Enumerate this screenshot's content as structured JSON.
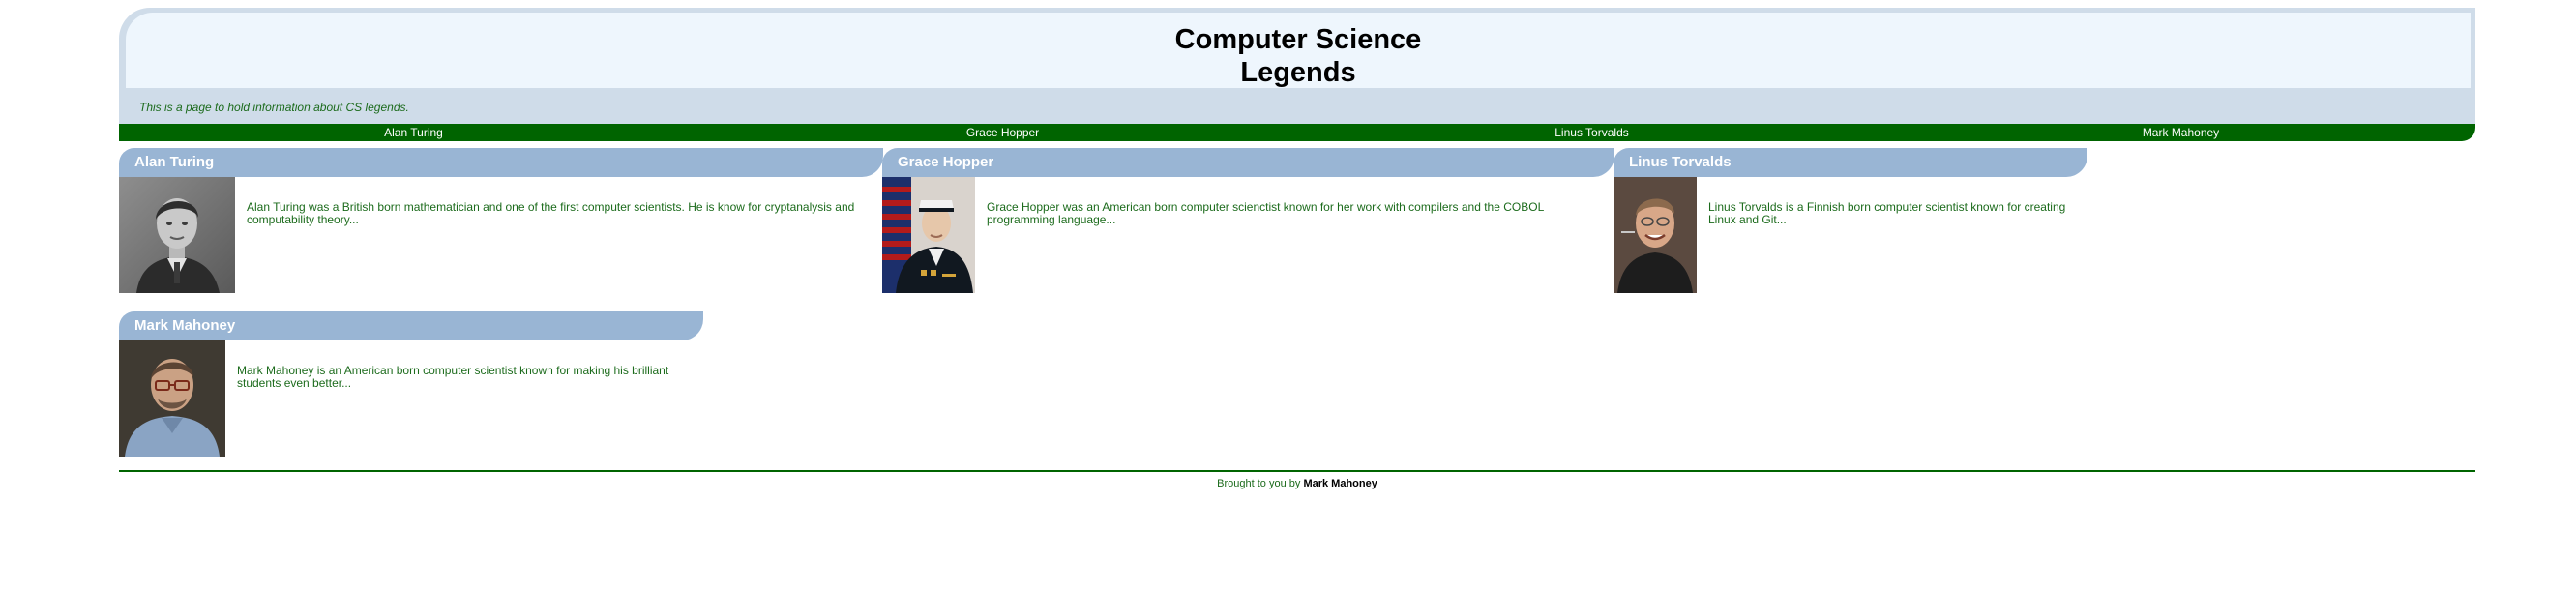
{
  "header": {
    "title_line1": "Computer Science",
    "title_line2": "Legends",
    "tagline": "This is a page to hold information about CS legends."
  },
  "nav": {
    "items": [
      "Alan Turing",
      "Grace Hopper",
      "Linus Torvalds",
      "Mark Mahoney"
    ]
  },
  "cards": [
    {
      "name": "Alan Turing",
      "description": "Alan Turing was a British born mathematician and one of the first computer scientists. He is know for cryptanalysis and computability theory..."
    },
    {
      "name": "Grace Hopper",
      "description": "Grace Hopper was an American born computer scienctist known for her work with compilers and the COBOL programming language..."
    },
    {
      "name": "Linus Torvalds",
      "description": "Linus Torvalds is a Finnish born computer scientist known for creating Linux and Git..."
    },
    {
      "name": "Mark Mahoney",
      "description": "Mark Mahoney is an American born computer scientist known for making his brilliant students even better..."
    }
  ],
  "footer": {
    "prefix": "Brought to you by",
    "author": "Mark Mahoney"
  },
  "colors": {
    "nav_bg": "#006400",
    "card_header": "#99b5d4",
    "header_bg": "#cfdce9",
    "title_bg": "#eef6fd",
    "text_green": "#1c6b1c"
  }
}
